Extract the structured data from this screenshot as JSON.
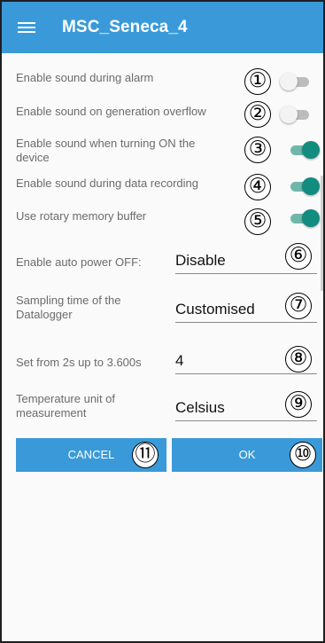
{
  "app": {
    "title": "MSC_Seneca_4"
  },
  "settings": [
    {
      "label": "Enable sound during alarm",
      "state": "off",
      "marker": "①"
    },
    {
      "label": "Enable sound on generation overflow",
      "state": "off",
      "marker": "②"
    },
    {
      "label": "Enable sound when turning ON the device",
      "state": "on",
      "marker": "③"
    },
    {
      "label": "Enable sound during data recording",
      "state": "on",
      "marker": "④"
    },
    {
      "label": "Use rotary memory buffer",
      "state": "on",
      "marker": "⑤"
    }
  ],
  "fields": [
    {
      "label": "Enable auto power OFF:",
      "value": "Disable",
      "marker": "⑥"
    },
    {
      "label": "Sampling time of the Datalogger",
      "value": "Customised",
      "marker": "⑦"
    },
    {
      "label": "Set from 2s up to 3.600s",
      "value": "4",
      "marker": "⑧"
    },
    {
      "label": "Temperature unit of measurement",
      "value": "Celsius",
      "marker": "⑨"
    }
  ],
  "buttons": {
    "cancel": {
      "label": "CANCEL",
      "marker": "⑪"
    },
    "ok": {
      "label": "OK",
      "marker": "⑩"
    }
  },
  "colors": {
    "accent": "#3a9ad9",
    "switch_on": "#128c7e"
  }
}
